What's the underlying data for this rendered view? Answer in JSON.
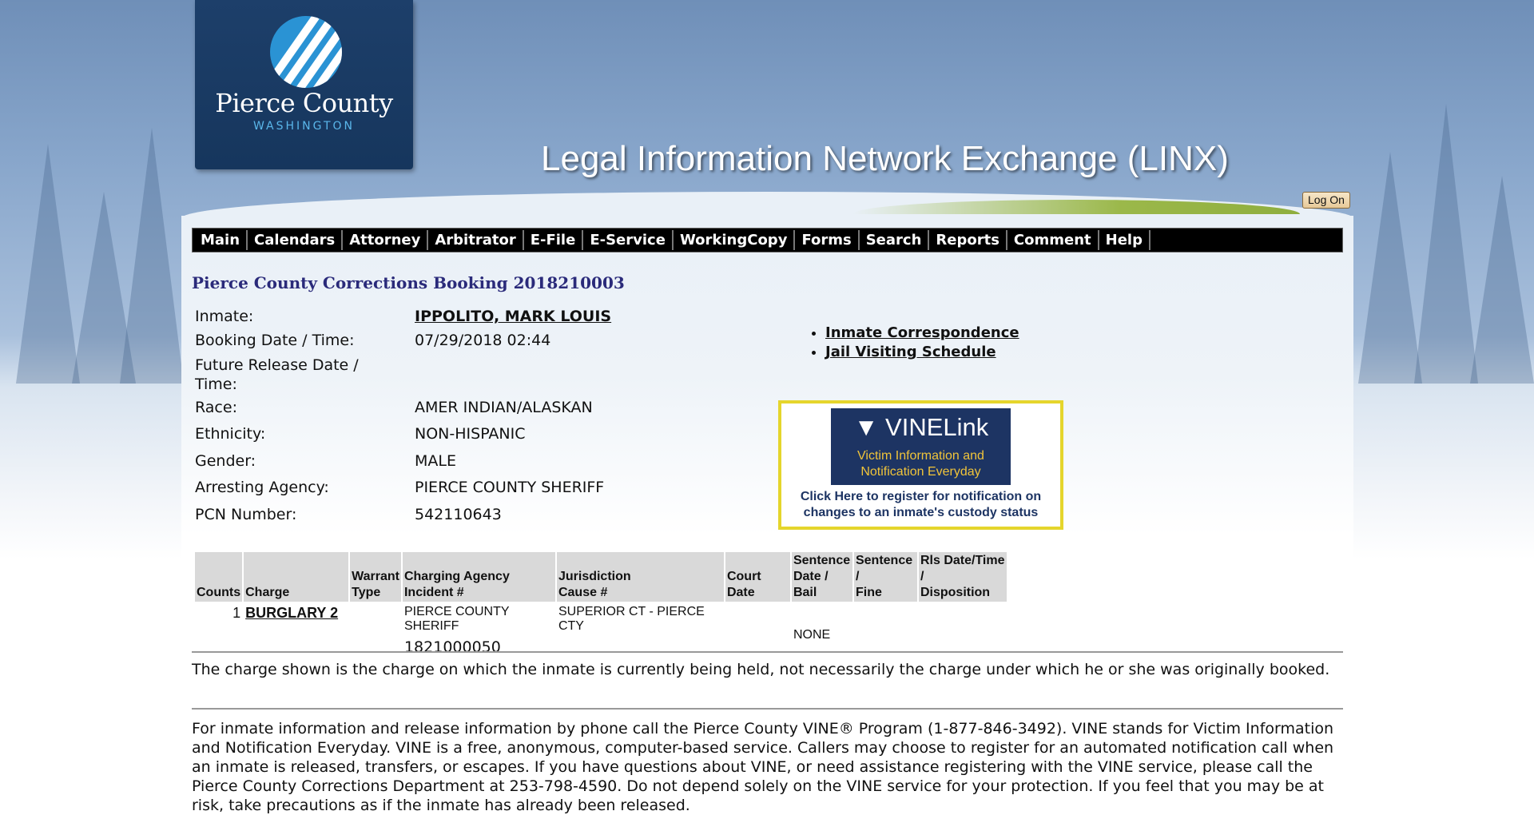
{
  "header": {
    "logo_title": "Pierce County",
    "logo_sub": "WASHINGTON",
    "site_title": "Legal Information Network Exchange (LINX)",
    "logon_label": "Log On"
  },
  "nav": {
    "items": [
      "Main",
      "Calendars",
      "Attorney",
      "Arbitrator",
      "E-File",
      "E-Service",
      "WorkingCopy",
      "Forms",
      "Search",
      "Reports",
      "Comment",
      "Help"
    ]
  },
  "booking": {
    "title": "Pierce County Corrections Booking 2018210003",
    "fields": [
      {
        "label": "Inmate:",
        "value": "IPPOLITO, MARK LOUIS"
      },
      {
        "label": "Booking Date / Time:",
        "value": "07/29/2018 02:44"
      },
      {
        "label": "Future Release Date / Time:",
        "value": ""
      },
      {
        "label": "Race:",
        "value": "AMER INDIAN/ALASKAN"
      },
      {
        "label": "Ethnicity:",
        "value": "NON-HISPANIC"
      },
      {
        "label": "Gender:",
        "value": "MALE"
      },
      {
        "label": "Arresting Agency:",
        "value": "PIERCE COUNTY SHERIFF"
      },
      {
        "label": "PCN Number:",
        "value": "542110643"
      }
    ]
  },
  "links": {
    "correspondence": "Inmate Correspondence",
    "visiting": "Jail Visiting Schedule"
  },
  "vine": {
    "logo": "VINELink",
    "tagline_1": "Victim Information and",
    "tagline_2": "Notification Everyday",
    "cta_1": "Click Here to register for notification on",
    "cta_2": "changes to an inmate's custody status",
    "border_color": "#e5d52c"
  },
  "charges_table": {
    "headers": {
      "counts": "Counts",
      "charge": "Charge",
      "warrant_1": "Warrant",
      "warrant_2": "Type",
      "agency_1": "Charging Agency",
      "agency_2": "Incident #",
      "jurisdiction_1": "Jurisdiction",
      "jurisdiction_2": "Cause #",
      "court_date": "Court Date",
      "sentence_1": "Sentence",
      "sentence_2": "Date / Bail",
      "fine_1": "Sentence /",
      "fine_2": "Fine",
      "rls_1": "Rls Date/Time /",
      "rls_2": "Disposition"
    },
    "row": {
      "counts": "1",
      "charge": "BURGLARY 2",
      "agency": "PIERCE COUNTY SHERIFF",
      "incident": "1821000050",
      "jurisdiction": "SUPERIOR CT - PIERCE CTY",
      "bail": "NONE"
    }
  },
  "notes": {
    "charge_note": "The charge shown is the charge on which the inmate is currently being held, not necessarily the charge under which he or she was originally booked.",
    "vine_info": "For inmate information and release information by phone call the Pierce County VINE® Program (1-877-846-3492).  VINE stands for Victim Information and Notification Everyday.  VINE is a free, anonymous, computer-based service.  Callers may choose to register for an automated notification call when an inmate is released, transfers, or escapes.  If you have questions about VINE, or need assistance registering with the VINE service, please call the Pierce County Corrections Department at 253-798-4590.  Do not depend solely on the VINE service for your protection.  If you feel that you may be at risk, take precautions as if the inmate has already been released."
  }
}
